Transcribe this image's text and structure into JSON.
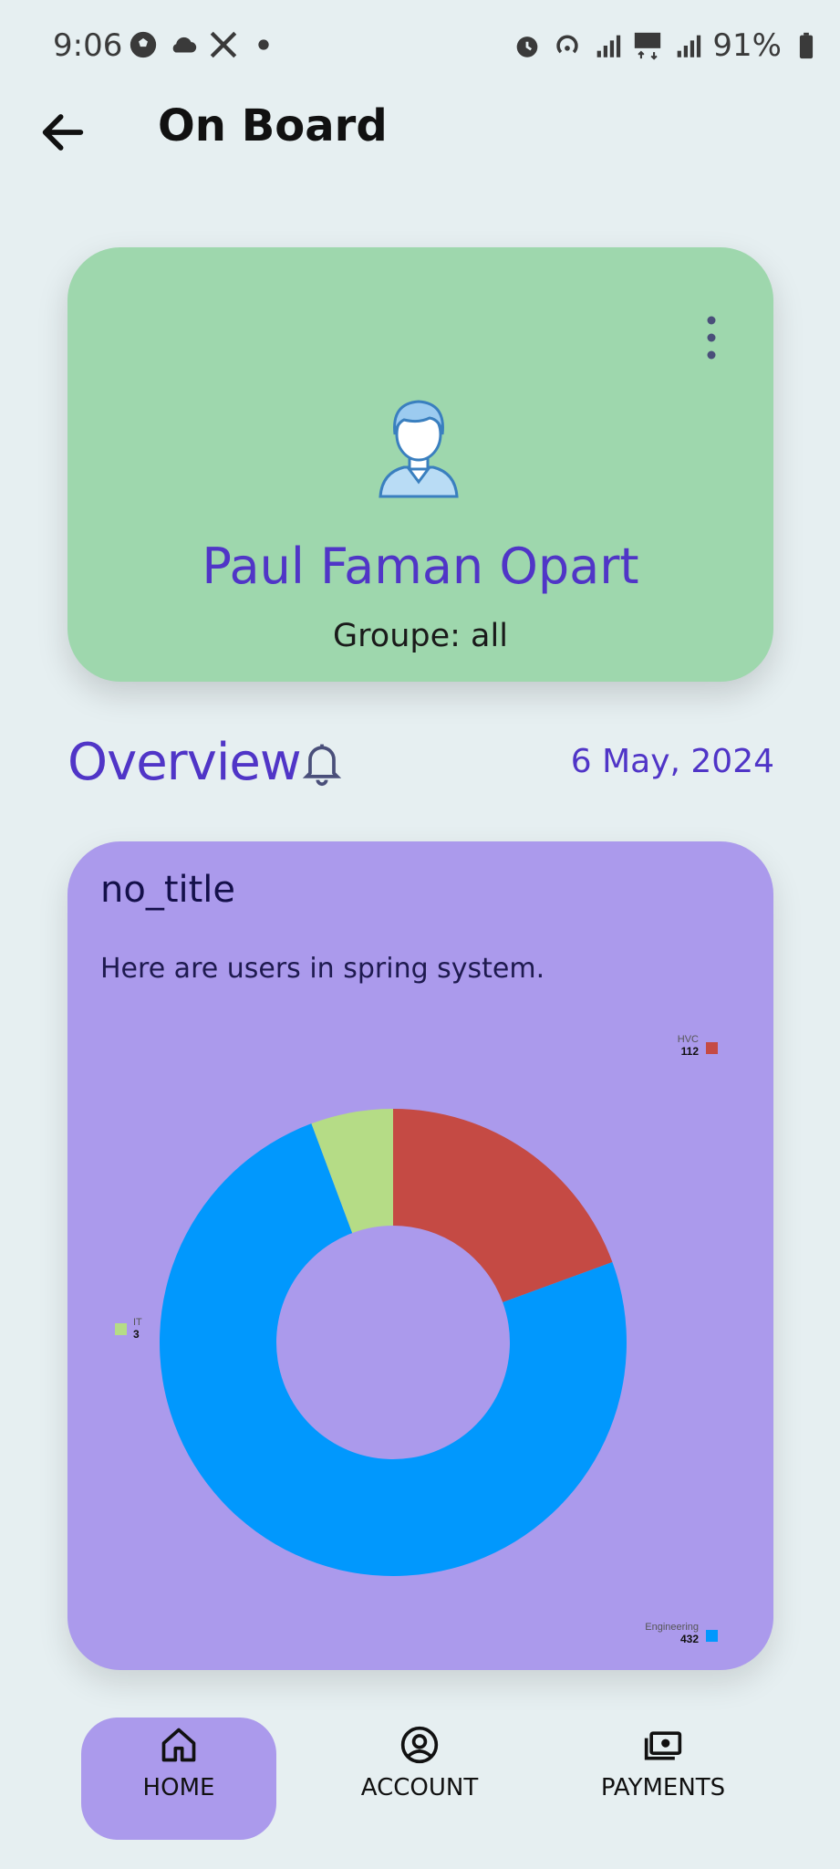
{
  "status_bar": {
    "time": "9:06",
    "battery": "91%",
    "left_icons": [
      "soccer-ball-icon",
      "cloud-icon",
      "x-logo-icon",
      "dot-icon"
    ],
    "right_icons": [
      "alarm-icon",
      "hotspot-icon",
      "signal-icon",
      "5g-icon",
      "signal-icon",
      "battery-icon"
    ]
  },
  "header": {
    "title": "On Board"
  },
  "profile": {
    "name": "Paul Faman Opart",
    "group_label": "Groupe:  all"
  },
  "overview": {
    "title": "Overview",
    "date": "6 May, 2024"
  },
  "chart_card": {
    "title": "no_title",
    "description": "Here are users in spring system."
  },
  "chart_data": {
    "type": "pie",
    "style": "donut",
    "categories": [
      "HVC",
      "Engineering",
      "IT"
    ],
    "values": [
      112,
      432,
      3
    ],
    "colors": [
      "#c54a44",
      "#0198fd",
      "#b5dc86"
    ],
    "legend": [
      {
        "name": "HVC",
        "value": "112"
      },
      {
        "name": "IT",
        "value": "3"
      },
      {
        "name": "Engineering",
        "value": "432"
      }
    ]
  },
  "nav": {
    "items": [
      {
        "label": "HOME",
        "icon": "home-icon",
        "active": true
      },
      {
        "label": "ACCOUNT",
        "icon": "account-icon",
        "active": false
      },
      {
        "label": "PAYMENTS",
        "icon": "payments-icon",
        "active": false
      }
    ]
  },
  "colors": {
    "background": "#e6eff1",
    "profile_card": "#9ed7ad",
    "chart_card": "#ab9aec",
    "accent": "#5035c7"
  }
}
